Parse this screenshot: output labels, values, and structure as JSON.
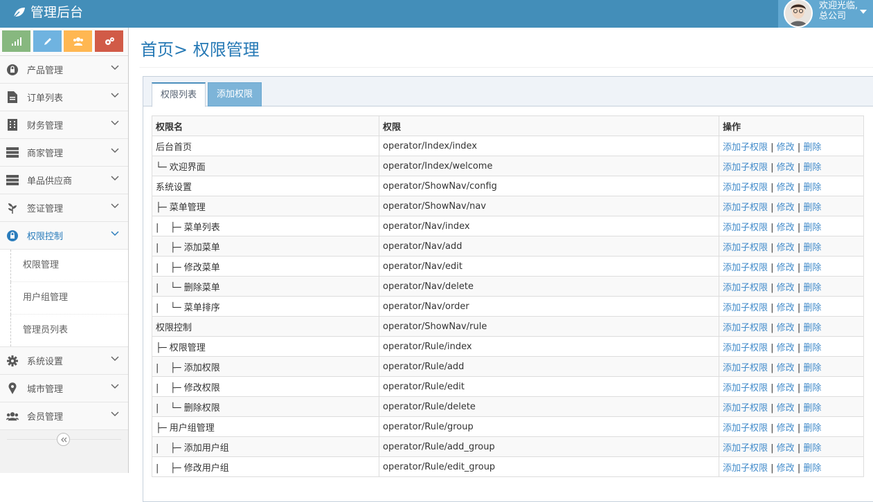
{
  "header": {
    "brand": "管理后台",
    "welcome_line1": "欢迎光临,",
    "welcome_line2": "总公司"
  },
  "colors": {
    "topbar": "#438eb9",
    "accent": "#2679b5",
    "shortcut_green": "#87b87f",
    "shortcut_blue": "#6fb3e0",
    "shortcut_orange": "#ffb752",
    "shortcut_red": "#d15b47"
  },
  "sidebar": {
    "items": [
      {
        "label": "产品管理",
        "icon": "lock-icon"
      },
      {
        "label": "订单列表",
        "icon": "file-icon"
      },
      {
        "label": "财务管理",
        "icon": "building-icon"
      },
      {
        "label": "商家管理",
        "icon": "server-icon"
      },
      {
        "label": "单品供应商",
        "icon": "server-icon"
      },
      {
        "label": "签证管理",
        "icon": "leaf-icon"
      },
      {
        "label": "权限控制",
        "icon": "lock-icon"
      }
    ],
    "submenu": [
      "权限管理",
      "用户组管理",
      "管理员列表"
    ],
    "items_after": [
      {
        "label": "系统设置",
        "icon": "gear-icon"
      },
      {
        "label": "城市管理",
        "icon": "map-marker-icon"
      },
      {
        "label": "会员管理",
        "icon": "users-icon"
      }
    ]
  },
  "main": {
    "title": "首页> 权限管理",
    "tabs": [
      "权限列表",
      "添加权限"
    ],
    "table": {
      "headers": [
        "权限名",
        "权限",
        "操作"
      ],
      "actions": {
        "add": "添加子权限",
        "sep": " | ",
        "edit": "修改",
        "delete": "删除"
      },
      "rows": [
        {
          "name": "后台首页",
          "rule": "operator/Index/index"
        },
        {
          "name": "└─ 欢迎界面",
          "rule": "operator/Index/welcome"
        },
        {
          "name": "系统设置",
          "rule": "operator/ShowNav/config"
        },
        {
          "name": "├─ 菜单管理",
          "rule": "operator/ShowNav/nav"
        },
        {
          "name": "|    ├─ 菜单列表",
          "rule": "operator/Nav/index"
        },
        {
          "name": "|    ├─ 添加菜单",
          "rule": "operator/Nav/add"
        },
        {
          "name": "|    ├─ 修改菜单",
          "rule": "operator/Nav/edit"
        },
        {
          "name": "|    └─ 删除菜单",
          "rule": "operator/Nav/delete"
        },
        {
          "name": "|    └─ 菜单排序",
          "rule": "operator/Nav/order"
        },
        {
          "name": "权限控制",
          "rule": "operator/ShowNav/rule"
        },
        {
          "name": "├─ 权限管理",
          "rule": "operator/Rule/index"
        },
        {
          "name": "|    ├─ 添加权限",
          "rule": "operator/Rule/add"
        },
        {
          "name": "|    ├─ 修改权限",
          "rule": "operator/Rule/edit"
        },
        {
          "name": "|    └─ 删除权限",
          "rule": "operator/Rule/delete"
        },
        {
          "name": "├─ 用户组管理",
          "rule": "operator/Rule/group"
        },
        {
          "name": "|    ├─ 添加用户组",
          "rule": "operator/Rule/add_group"
        },
        {
          "name": "|    ├─ 修改用户组",
          "rule": "operator/Rule/edit_group"
        }
      ]
    }
  }
}
